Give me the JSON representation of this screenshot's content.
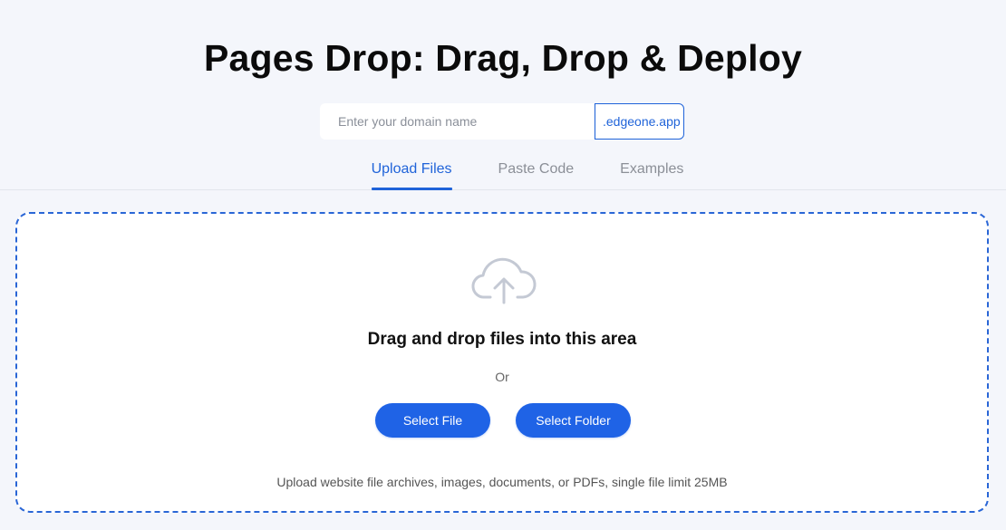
{
  "header": {
    "title": "Pages Drop: Drag, Drop & Deploy"
  },
  "domain": {
    "placeholder": "Enter your domain name",
    "value": "",
    "suffix": ".edgeone.app"
  },
  "tabs": [
    {
      "label": "Upload Files",
      "active": true
    },
    {
      "label": "Paste Code",
      "active": false
    },
    {
      "label": "Examples",
      "active": false
    }
  ],
  "dropzone": {
    "icon": "cloud-upload-icon",
    "heading": "Drag and drop files into this area",
    "or_text": "Or",
    "select_file_label": "Select File",
    "select_folder_label": "Select Folder",
    "hint": "Upload website file archives, images, documents, or PDFs, single file limit 25MB"
  },
  "colors": {
    "accent": "#1f63e6",
    "background": "#f4f6fb",
    "icon_gray": "#c4c9d4"
  }
}
